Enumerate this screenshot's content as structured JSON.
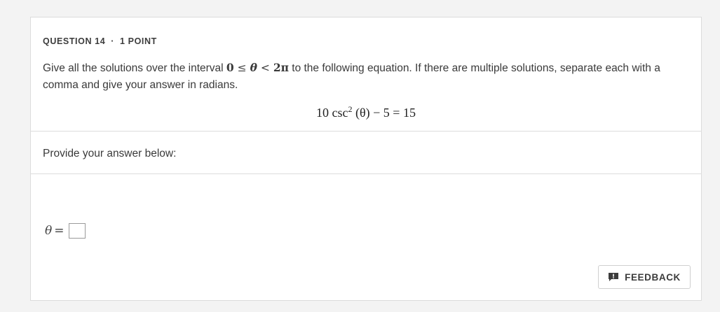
{
  "question": {
    "number_label": "QUESTION 14",
    "separator": "·",
    "points_label": "1 POINT",
    "text_before_interval": "Give all the solutions over the interval ",
    "interval": {
      "lower": "0",
      "leq": "≤",
      "var": "θ",
      "lt": "<",
      "upper": "2π"
    },
    "text_after_interval": " to the following equation. If there are multiple solutions, separate each with a comma and give your answer in radians.",
    "equation": {
      "coef": "10 csc",
      "exponent": "2",
      "argument": " (θ) − 5 = 15"
    }
  },
  "answer_section": {
    "label": "Provide your answer below:",
    "variable": "θ",
    "equals": "=",
    "input_value": ""
  },
  "feedback_button": {
    "label": "FEEDBACK",
    "icon": "feedback-icon"
  },
  "colors": {
    "background": "#f3f3f3",
    "card": "#ffffff",
    "border": "#dcdcdc",
    "text": "#3a3a3a"
  }
}
